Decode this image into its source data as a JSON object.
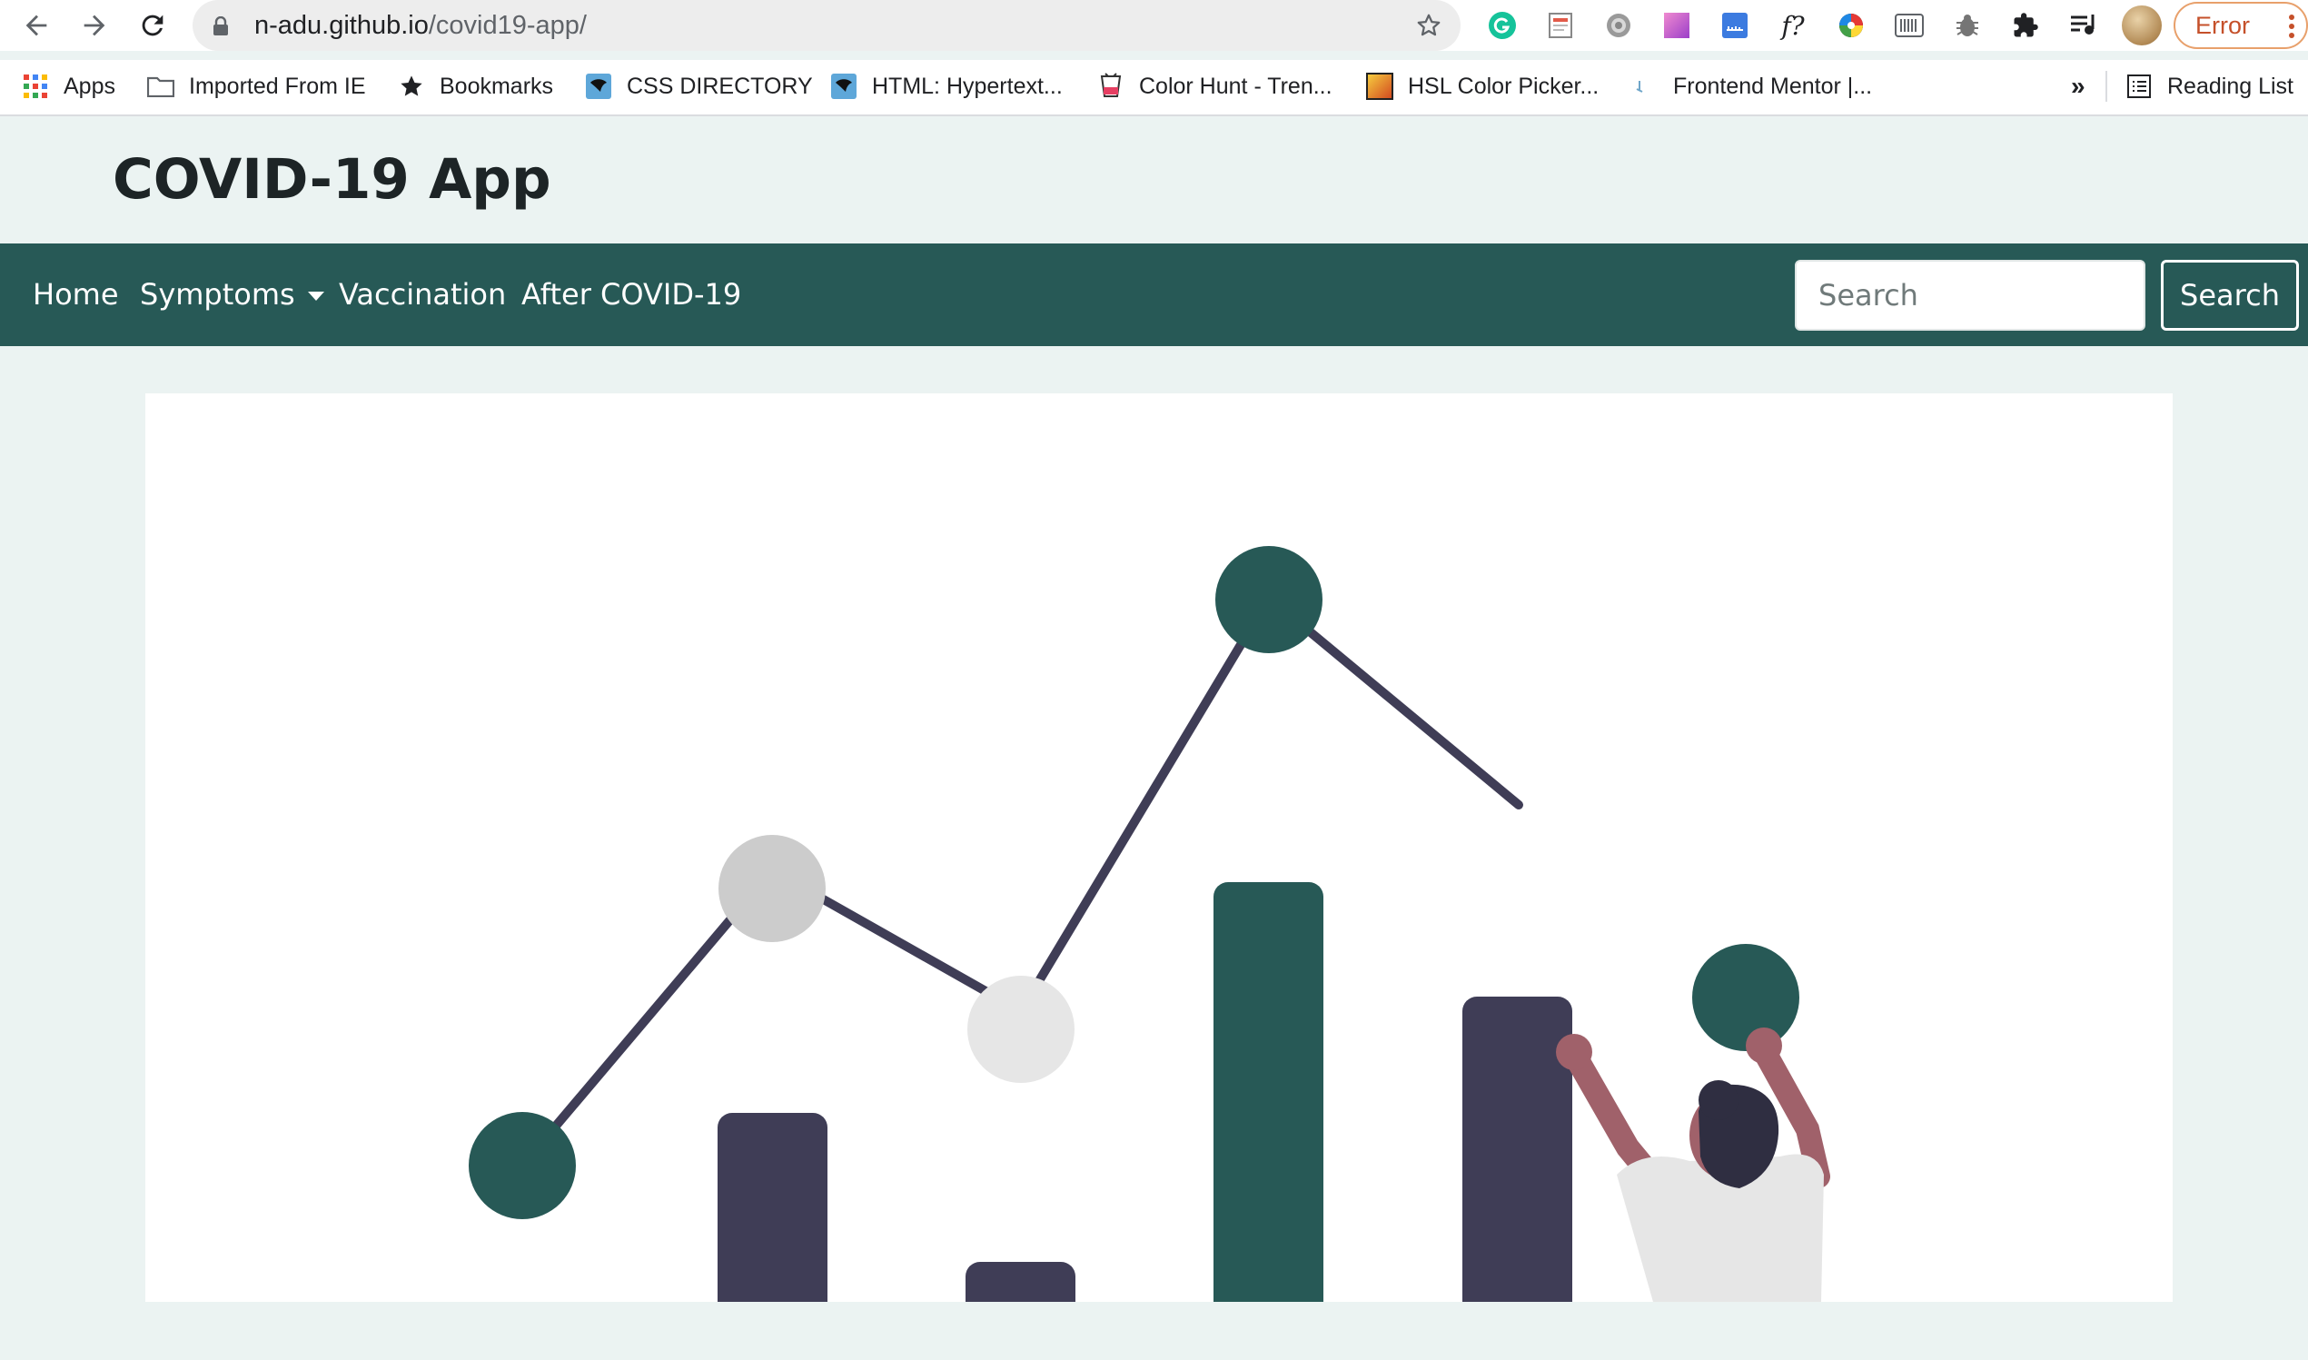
{
  "browser": {
    "url_host": "n-adu.github.io",
    "url_path": "/covid19-app/",
    "error_label": "Error",
    "extensions": [
      "grammarly-icon",
      "page-icon",
      "gear-extension-icon",
      "swatch-icon",
      "ruler-icon",
      "font-icon",
      "color-wheel-icon",
      "barcode-icon",
      "bug-icon",
      "puzzle-icon",
      "playlist-icon"
    ],
    "font_extension_glyph": "f?",
    "bookmarks": [
      {
        "label": "Apps",
        "icon": "apps-grid-icon"
      },
      {
        "label": "Imported From IE",
        "icon": "folder-icon"
      },
      {
        "label": "Bookmarks",
        "icon": "star-icon"
      },
      {
        "label": "CSS DIRECTORY",
        "icon": "site-favicon"
      },
      {
        "label": "HTML: Hypertext...",
        "icon": "mdn-favicon"
      },
      {
        "label": "Color Hunt - Tren...",
        "icon": "colorhunt-favicon"
      },
      {
        "label": "HSL Color Picker...",
        "icon": "hsl-favicon"
      },
      {
        "label": "Frontend Mentor |...",
        "icon": "frontend-mentor-favicon"
      }
    ],
    "overflow_label": "»",
    "reading_list_label": "Reading List"
  },
  "site": {
    "brand": "COVID-19 App",
    "nav": {
      "home": "Home",
      "symptoms": "Symptoms",
      "vaccination": "Vaccination",
      "after": "After COVID-19"
    },
    "search": {
      "placeholder": "Search",
      "button": "Search"
    }
  },
  "colors": {
    "brand_teal": "#275956",
    "page_bg": "#ebf3f2",
    "illustration_dark": "#3f3d56",
    "illustration_light_grey": "#cccccc",
    "skin": "#a0616a"
  },
  "hero": {
    "illustration": "person-with-bar-and-line-chart-illustration"
  }
}
